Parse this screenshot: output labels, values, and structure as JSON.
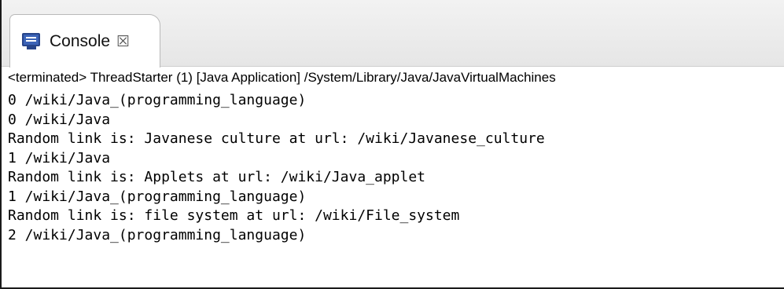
{
  "tab": {
    "label": "Console",
    "icon": "console-icon",
    "close_glyph": "☒"
  },
  "status_line": "<terminated> ThreadStarter (1) [Java Application] /System/Library/Java/JavaVirtualMachines",
  "console": {
    "lines": [
      "0 /wiki/Java_(programming_language)",
      "0 /wiki/Java",
      "Random link is: Javanese culture at url: /wiki/Javanese_culture",
      "1 /wiki/Java",
      "Random link is: Applets at url: /wiki/Java_applet",
      "1 /wiki/Java_(programming_language)",
      "Random link is: file system at url: /wiki/File_system",
      "2 /wiki/Java_(programming_language)"
    ]
  }
}
